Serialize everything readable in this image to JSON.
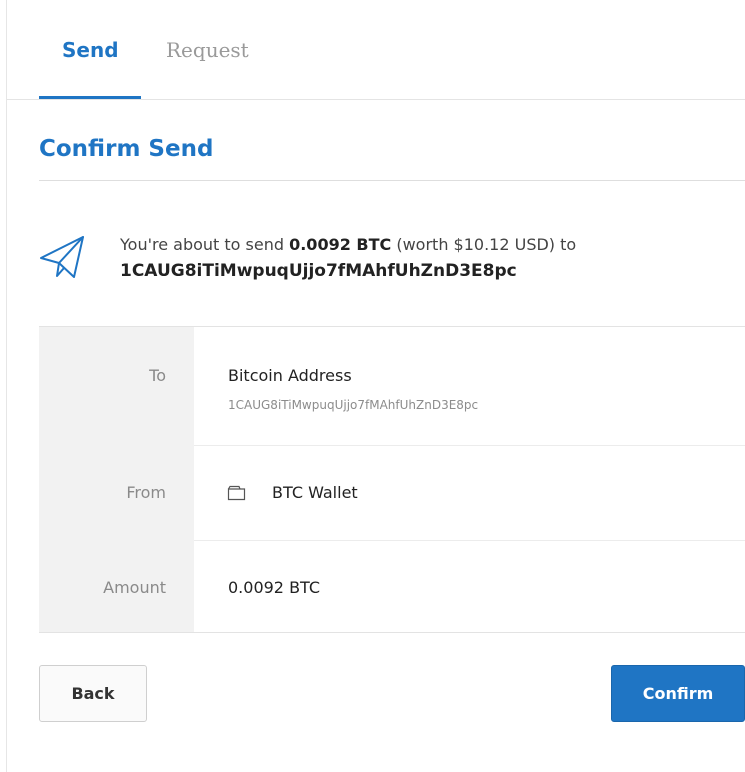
{
  "tabs": {
    "send": "Send",
    "request": "Request"
  },
  "heading": "Confirm Send",
  "message": {
    "prefix": "You're about to send ",
    "amount": "0.0092 BTC",
    "worth": " (worth $10.12 USD) to",
    "address": "1CAUG8iTiMwpuqUjjo7fMAhfUhZnD3E8pc"
  },
  "details": {
    "to_label": "To",
    "to_title": "Bitcoin Address",
    "to_address": "1CAUG8iTiMwpuqUjjo7fMAhfUhZnD3E8pc",
    "from_label": "From",
    "from_wallet": "BTC Wallet",
    "amount_label": "Amount",
    "amount_value": "0.0092 BTC"
  },
  "buttons": {
    "back": "Back",
    "confirm": "Confirm"
  },
  "icons": {
    "send": "paper-plane-icon",
    "wallet": "wallet-icon"
  },
  "colors": {
    "accent": "#1f75c4"
  }
}
